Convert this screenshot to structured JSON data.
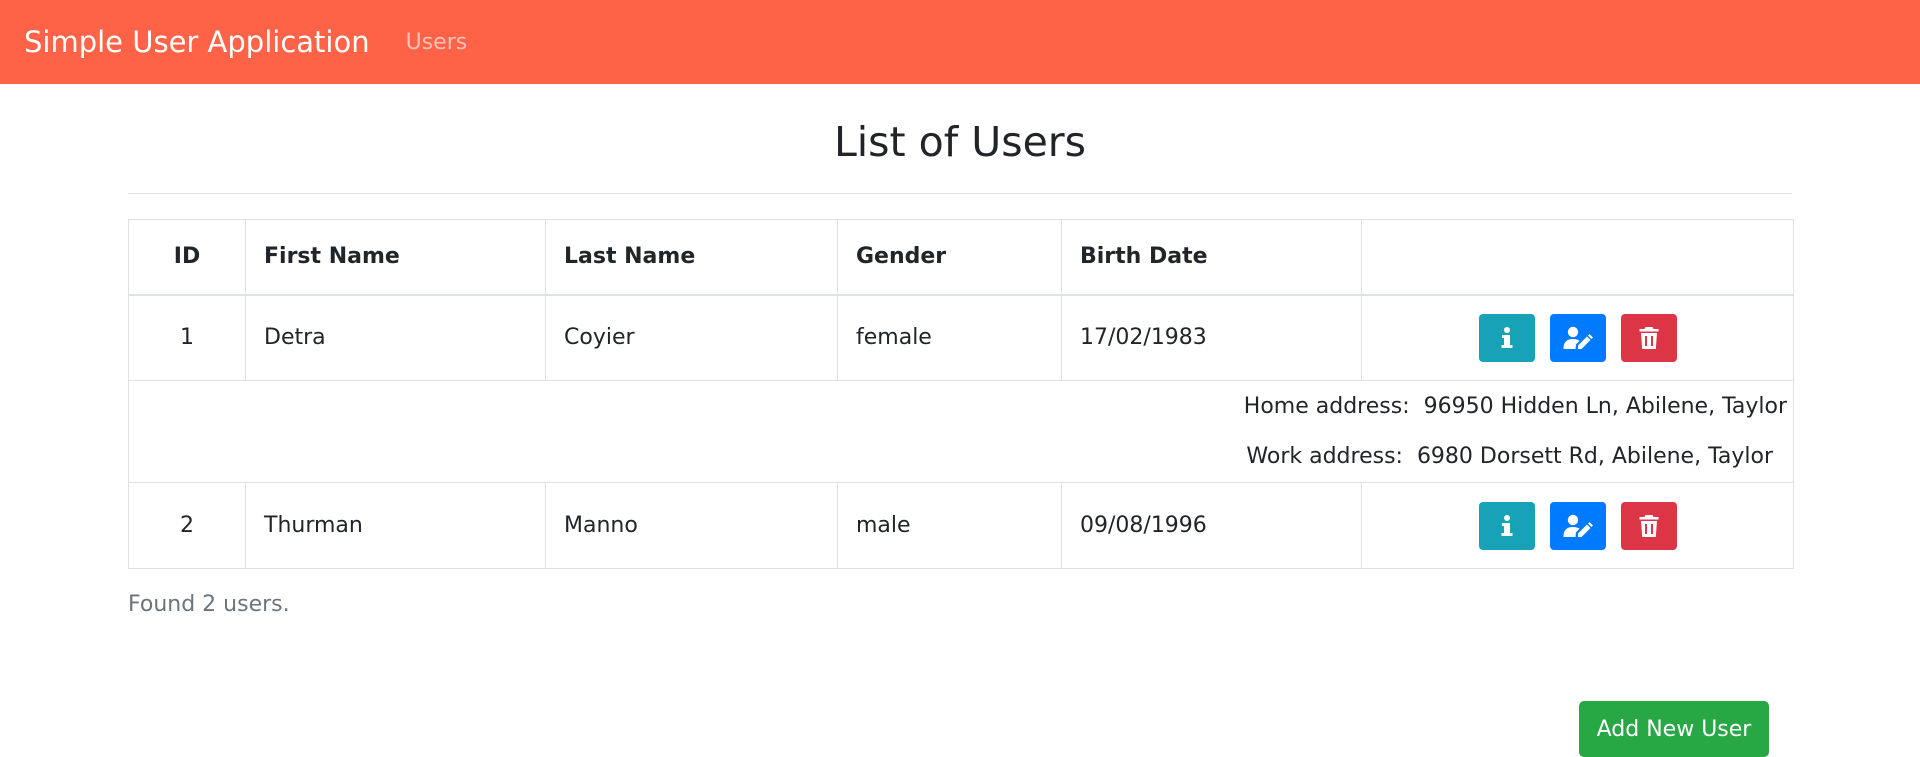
{
  "navbar": {
    "brand": "Simple User Application",
    "links": [
      "Users"
    ],
    "background_color": "#ff6347"
  },
  "page": {
    "title": "List of Users"
  },
  "table": {
    "columns": [
      "ID",
      "First Name",
      "Last Name",
      "Gender",
      "Birth Date",
      ""
    ],
    "rows": [
      {
        "id": "1",
        "first_name": "Detra",
        "last_name": "Coyier",
        "gender": "female",
        "birth_date": "17/02/1983",
        "details": {
          "home_label": "Home address:",
          "home_value": "96950 Hidden Ln, Abilene, Taylor",
          "work_label": "Work address:",
          "work_value": "6980 Dorsett Rd, Abilene, Taylor"
        }
      },
      {
        "id": "2",
        "first_name": "Thurman",
        "last_name": "Manno",
        "gender": "male",
        "birth_date": "09/08/1996"
      }
    ],
    "action_icons": [
      "info-icon",
      "user-edit-icon",
      "trash-icon"
    ],
    "action_colors": {
      "info": "#17a2b8",
      "edit": "#007bff",
      "delete": "#dc3545"
    }
  },
  "footer": {
    "found_text": "Found 2 users.",
    "add_button_label": "Add New User",
    "add_button_color": "#28a745"
  }
}
